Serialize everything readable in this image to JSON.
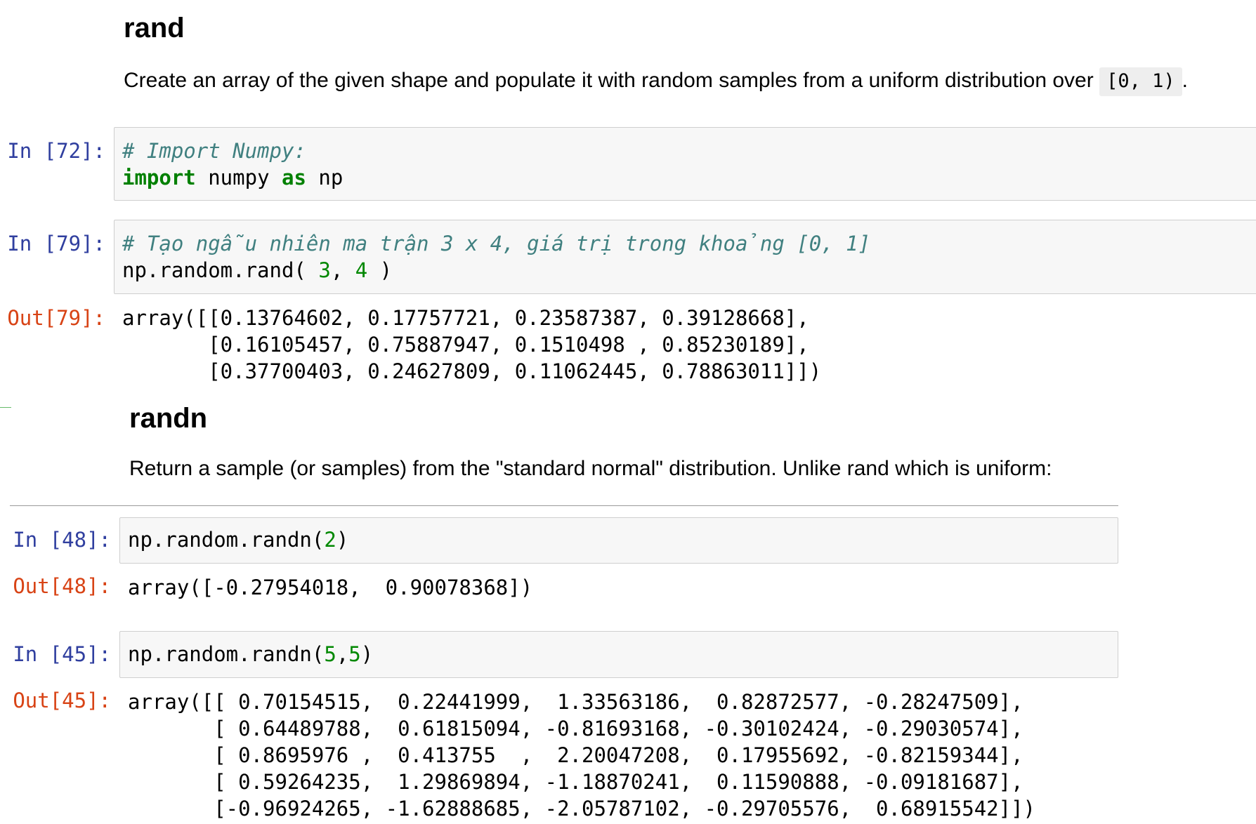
{
  "section_rand": {
    "heading": "rand",
    "description": "Create an array of the given shape and populate it with random samples from a uniform distribution over",
    "inline_code": "[0, 1)",
    "trailing": "."
  },
  "cell_72": {
    "prompt": "In [72]:",
    "line1_comment": "# Import Numpy:",
    "line2_kw1": "import",
    "line2_mid": " numpy ",
    "line2_kw2": "as",
    "line2_end": " np"
  },
  "cell_79": {
    "prompt": "In [79]:",
    "line1_comment": "# Tạo ngẫu nhiên ma trận 3 x 4, giá trị trong khoảng [0, 1]",
    "line2_a": "np.random.rand( ",
    "line2_n1": "3",
    "line2_b": ", ",
    "line2_n2": "4",
    "line2_c": " )",
    "out_prompt": "Out[79]:",
    "output_lines": [
      "array([[0.13764602, 0.17757721, 0.23587387, 0.39128668],",
      "       [0.16105457, 0.75887947, 0.1510498 , 0.85230189],",
      "       [0.37700403, 0.24627809, 0.11062445, 0.78863011]])"
    ]
  },
  "section_randn": {
    "heading": "randn",
    "description": "Return a sample (or samples) from the \"standard normal\" distribution. Unlike rand which is uniform:"
  },
  "cell_48": {
    "prompt": "In [48]:",
    "code_a": "np.random.randn(",
    "code_n": "2",
    "code_b": ")",
    "out_prompt": "Out[48]:",
    "output": "array([-0.27954018,  0.90078368])"
  },
  "cell_45": {
    "prompt": "In [45]:",
    "code_a": "np.random.randn(",
    "code_n1": "5",
    "code_sep": ",",
    "code_n2": "5",
    "code_b": ")",
    "out_prompt": "Out[45]:",
    "output_lines": [
      "array([[ 0.70154515,  0.22441999,  1.33563186,  0.82872577, -0.28247509],",
      "       [ 0.64489788,  0.61815094, -0.81693168, -0.30102424, -0.29030574],",
      "       [ 0.8695976 ,  0.413755  ,  2.20047208,  0.17955692, -0.82159344],",
      "       [ 0.59264235,  1.29869894, -1.18870241,  0.11590888, -0.09181687],",
      "       [-0.96924265, -1.62888685, -2.05787102, -0.29705576,  0.68915542]])"
    ]
  }
}
